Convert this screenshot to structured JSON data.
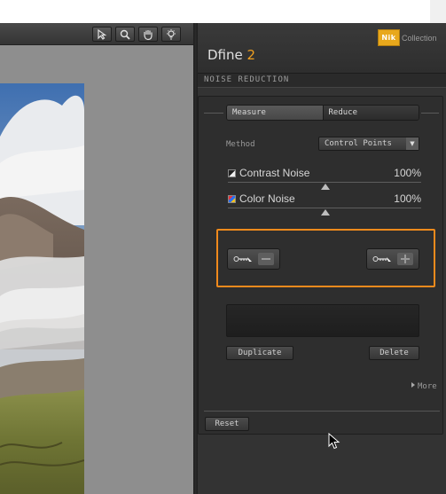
{
  "app": {
    "title_name": "Dfine",
    "title_version": "2",
    "logo_text": "Nik",
    "logo_sub": "Collection",
    "brand_color": "#e8a81c",
    "accent_color": "#f08a1c"
  },
  "toolbar": {
    "tools": [
      {
        "name": "pointer-icon"
      },
      {
        "name": "zoom-icon"
      },
      {
        "name": "hand-icon"
      },
      {
        "name": "light-icon"
      }
    ]
  },
  "section": {
    "title": "NOISE REDUCTION"
  },
  "mode": {
    "options": [
      "Measure",
      "Reduce"
    ],
    "selected": "Measure"
  },
  "method": {
    "label": "Method",
    "value": "Control Points"
  },
  "sliders": [
    {
      "label": "Contrast Noise",
      "value": "100%",
      "level": 1.0
    },
    {
      "label": "Color Noise",
      "value": "100%",
      "level": 1.0
    }
  ],
  "control_points": {
    "remove_icon": "minus-icon",
    "add_icon": "plus-icon"
  },
  "buttons": {
    "duplicate": "Duplicate",
    "delete": "Delete",
    "more": "More",
    "reset": "Reset"
  }
}
